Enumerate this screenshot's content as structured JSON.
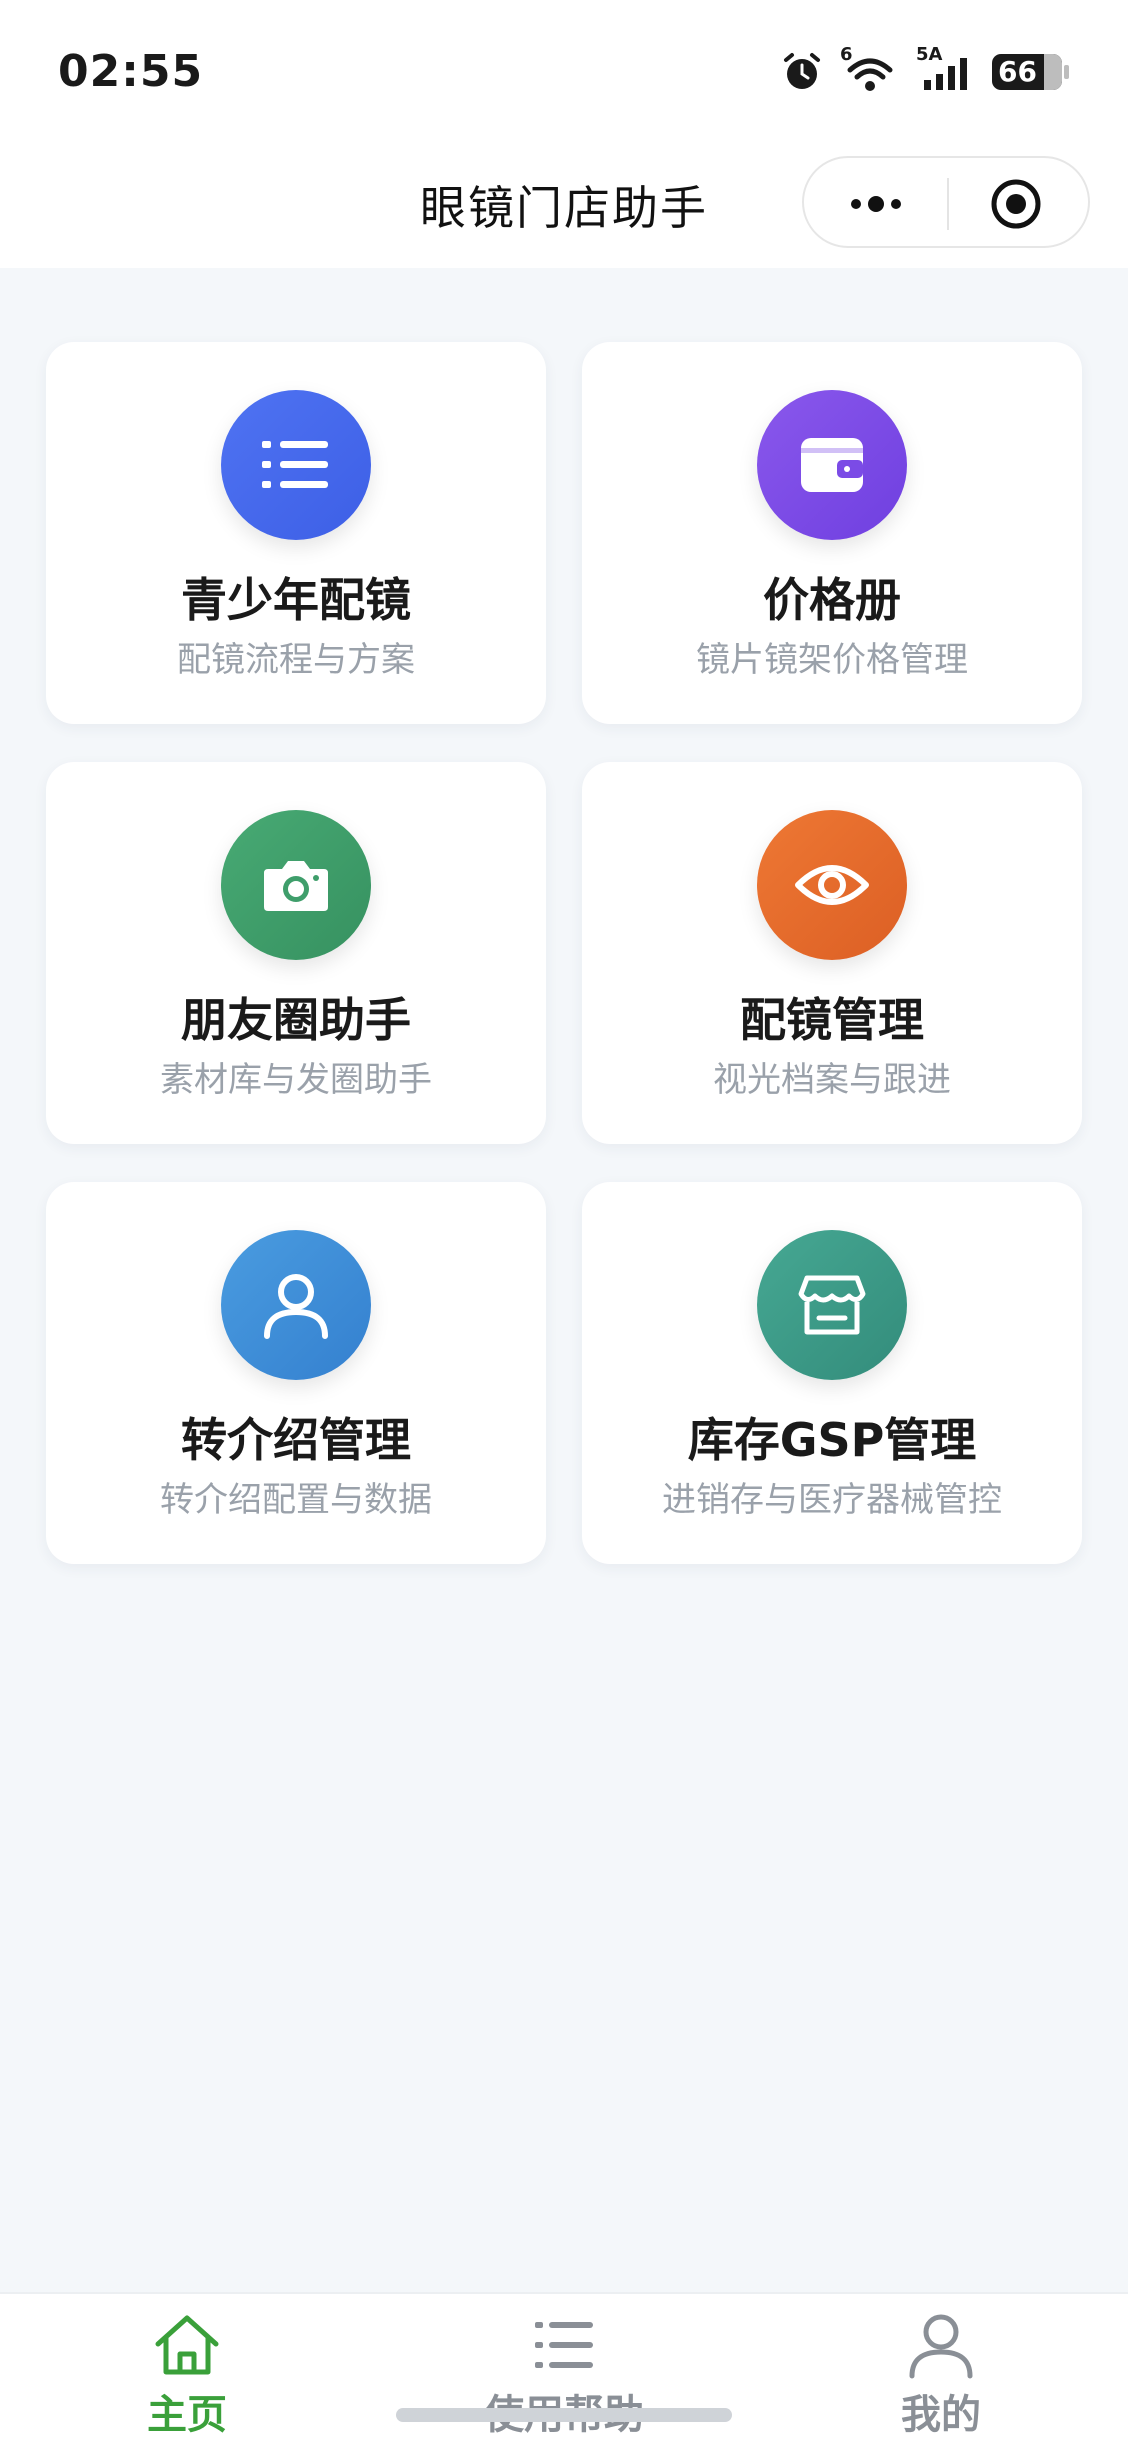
{
  "status_bar": {
    "time": "02:55",
    "signal_labels": [
      "6",
      "5A"
    ],
    "battery": "66"
  },
  "nav": {
    "title": "眼镜门店助手"
  },
  "cards": [
    {
      "title": "青少年配镜",
      "subtitle": "配镜流程与方案",
      "icon": "list-icon",
      "color": "#4a6cf0"
    },
    {
      "title": "价格册",
      "subtitle": "镜片镜架价格管理",
      "icon": "wallet-icon",
      "color": "#7b4be6"
    },
    {
      "title": "朋友圈助手",
      "subtitle": "素材库与发圈助手",
      "icon": "camera-icon",
      "color": "#3f9e6b"
    },
    {
      "title": "配镜管理",
      "subtitle": "视光档案与跟进",
      "icon": "eye-icon",
      "color": "#e56a2c"
    },
    {
      "title": "转介绍管理",
      "subtitle": "转介绍配置与数据",
      "icon": "user-icon",
      "color": "#3e8fd8"
    },
    {
      "title": "库存GSP管理",
      "subtitle": "进销存与医疗器械管控",
      "icon": "store-icon",
      "color": "#3c9a88"
    }
  ],
  "tabbar": {
    "items": [
      {
        "label": "主页",
        "icon": "home-icon",
        "active": true
      },
      {
        "label": "使用帮助",
        "icon": "list-icon",
        "active": false
      },
      {
        "label": "我的",
        "icon": "user-icon",
        "active": false
      }
    ],
    "active_color": "#3aa03a",
    "inactive_color": "#8a8f96"
  }
}
